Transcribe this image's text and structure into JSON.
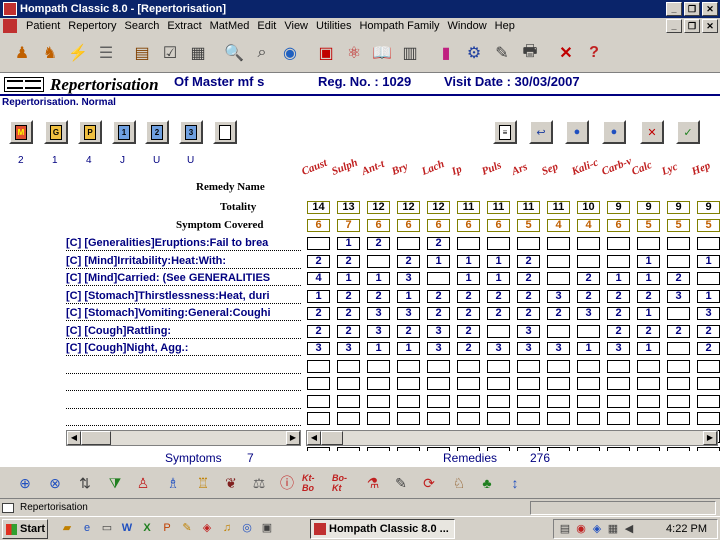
{
  "window": {
    "title": "Hompath Classic 8.0 - [Repertorisation]"
  },
  "menu": [
    "Patient",
    "Repertory",
    "Search",
    "Extract",
    "MatMed",
    "Edit",
    "View",
    "Utilities",
    "Hompath Family",
    "Window",
    "Hep"
  ],
  "header": {
    "title": "Repertorisation",
    "patient": "Of Master  mf    s",
    "reg": "Reg. No. : 1029",
    "visit": "Visit Date : 30/03/2007"
  },
  "subheader": "Repertorisation. Normal",
  "counts_row": [
    "2",
    "1",
    "4",
    "J",
    "U",
    "U"
  ],
  "labels": {
    "remedy": "Remedy Name",
    "totality": "Totality",
    "covered": "Symptom Covered"
  },
  "remedies": [
    "Caust",
    "Sulph",
    "Ant-t",
    "Bry",
    "Lach",
    "Ip",
    "Puls",
    "Ars",
    "Sep",
    "Kali-c",
    "Carb-v",
    "Calc",
    "Lyc",
    "Hep"
  ],
  "totality": [
    "14",
    "13",
    "12",
    "12",
    "12",
    "11",
    "11",
    "11",
    "11",
    "10",
    "9",
    "9",
    "9",
    "9"
  ],
  "covered": [
    "6",
    "7",
    "6",
    "6",
    "6",
    "6",
    "6",
    "5",
    "4",
    "4",
    "6",
    "5",
    "5",
    "5"
  ],
  "rubrics": [
    {
      "label": "[C] [Generalities]Eruptions:Fail to brea",
      "values": [
        "",
        "1",
        "2",
        "",
        "2",
        "",
        "",
        "",
        "",
        "",
        "",
        "",
        "",
        ""
      ]
    },
    {
      "label": "[C] [Mind]Irritability:Heat:With:",
      "values": [
        "2",
        "2",
        "",
        "2",
        "1",
        "1",
        "1",
        "2",
        "",
        "",
        "",
        "1",
        "",
        "1"
      ]
    },
    {
      "label": "[C] [Mind]Carried: (See GENERALITIES",
      "values": [
        "4",
        "1",
        "1",
        "3",
        "",
        "1",
        "1",
        "2",
        "",
        "2",
        "1",
        "1",
        "2",
        ""
      ]
    },
    {
      "label": "[C] [Stomach]Thirstlessness:Heat, duri",
      "values": [
        "1",
        "2",
        "2",
        "1",
        "2",
        "2",
        "2",
        "2",
        "3",
        "2",
        "2",
        "2",
        "3",
        "1"
      ]
    },
    {
      "label": "[C] [Stomach]Vomiting:General:Coughi",
      "values": [
        "2",
        "2",
        "3",
        "3",
        "2",
        "2",
        "2",
        "2",
        "2",
        "3",
        "2",
        "1",
        "",
        "3"
      ]
    },
    {
      "label": "[C] [Cough]Rattling:",
      "values": [
        "2",
        "2",
        "3",
        "2",
        "3",
        "2",
        "",
        "3",
        "",
        "",
        "2",
        "2",
        "2",
        "2"
      ]
    },
    {
      "label": "[C] [Cough]Night, Agg.:",
      "values": [
        "3",
        "3",
        "1",
        "1",
        "3",
        "2",
        "3",
        "3",
        "3",
        "1",
        "3",
        "1",
        "",
        "2"
      ]
    }
  ],
  "footer": {
    "symptoms_label": "Symptoms",
    "symptoms": "7",
    "remedies_label": "Remedies",
    "remedies": "276"
  },
  "statusbar": "Repertorisation",
  "taskbar": {
    "start": "Start",
    "task": "Hompath Classic 8.0 ...",
    "clock": "4:22 PM"
  }
}
